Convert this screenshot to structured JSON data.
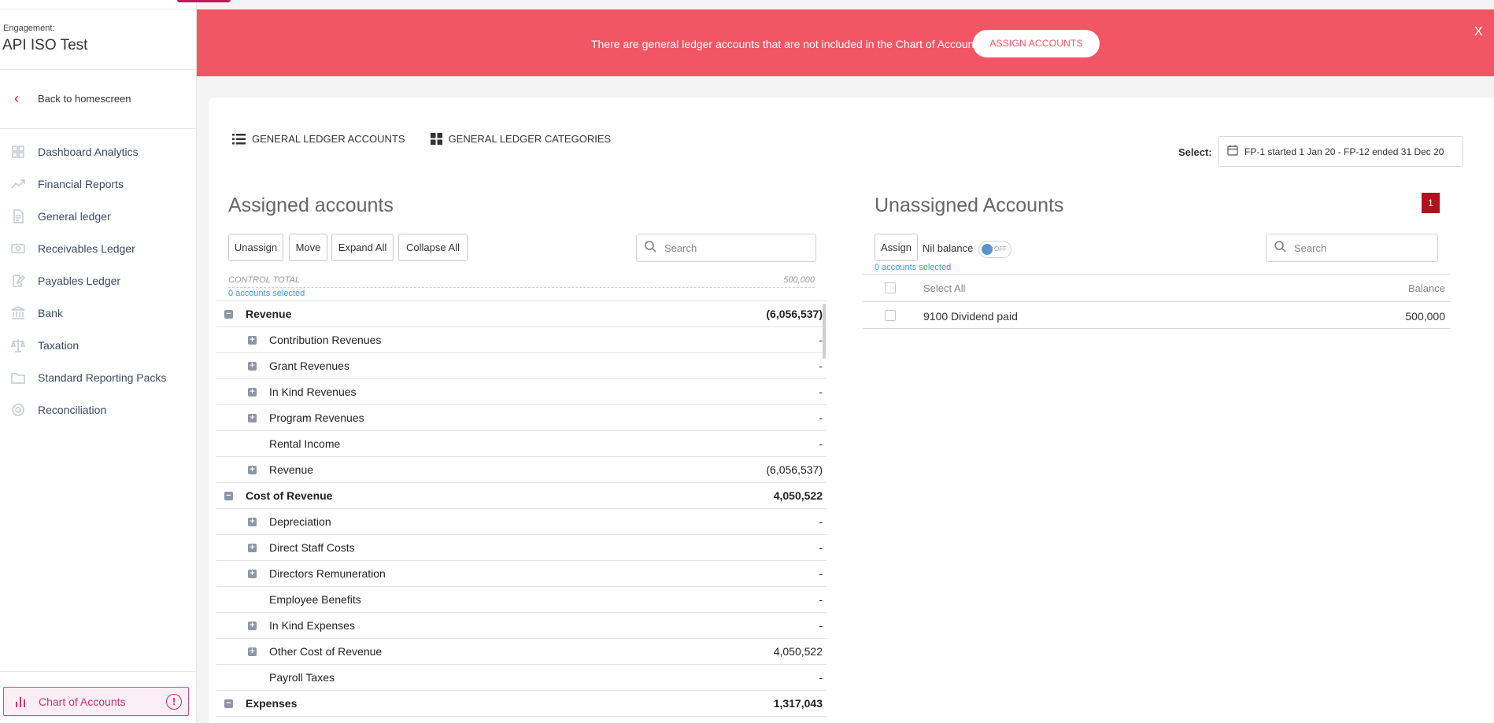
{
  "engagement": {
    "label": "Engagement:",
    "name": "API ISO Test"
  },
  "back_label": "Back to homescreen",
  "nav": [
    {
      "label": "Dashboard Analytics",
      "icon": "dashboard-icon"
    },
    {
      "label": "Financial Reports",
      "icon": "trend-icon"
    },
    {
      "label": "General ledger",
      "icon": "document-icon"
    },
    {
      "label": "Receivables Ledger",
      "icon": "money-icon"
    },
    {
      "label": "Payables Ledger",
      "icon": "edit-icon"
    },
    {
      "label": "Bank",
      "icon": "bank-icon"
    },
    {
      "label": "Taxation",
      "icon": "scales-icon"
    },
    {
      "label": "Standard Reporting Packs",
      "icon": "folder-icon"
    },
    {
      "label": "Reconciliation",
      "icon": "target-icon"
    }
  ],
  "chart_of_accounts": {
    "label": "Chart of Accounts",
    "warning": "!"
  },
  "banner": {
    "message": "There are general ledger accounts that are not included in the Chart of Accounts",
    "button": "ASSIGN ACCOUNTS",
    "close": "X"
  },
  "tabs": {
    "accounts": "GENERAL LEDGER ACCOUNTS",
    "categories": "GENERAL LEDGER CATEGORIES"
  },
  "select": {
    "label": "Select:",
    "value": "FP-1 started 1 Jan 20 - FP-12 ended 31 Dec 20"
  },
  "assigned": {
    "title": "Assigned accounts",
    "buttons": {
      "unassign": "Unassign",
      "move": "Move",
      "expand": "Expand All",
      "collapse": "Collapse All"
    },
    "search_placeholder": "Search",
    "control_total_label": "CONTROL TOTAL",
    "control_total_value": "500,000",
    "selected": "0 accounts selected",
    "rows": [
      {
        "level": "parent",
        "toggle": "−",
        "label": "Revenue",
        "amount": "(6,056,537)"
      },
      {
        "level": "child",
        "toggle": "+",
        "label": "Contribution Revenues",
        "amount": "-"
      },
      {
        "level": "child",
        "toggle": "+",
        "label": "Grant Revenues",
        "amount": "-"
      },
      {
        "level": "child",
        "toggle": "+",
        "label": "In Kind Revenues",
        "amount": "-"
      },
      {
        "level": "child",
        "toggle": "+",
        "label": "Program Revenues",
        "amount": "-"
      },
      {
        "level": "child",
        "toggle": "",
        "label": "Rental Income",
        "amount": "-"
      },
      {
        "level": "child",
        "toggle": "+",
        "label": "Revenue",
        "amount": "(6,056,537)"
      },
      {
        "level": "parent",
        "toggle": "−",
        "label": "Cost of Revenue",
        "amount": "4,050,522"
      },
      {
        "level": "child",
        "toggle": "+",
        "label": "Depreciation",
        "amount": "-"
      },
      {
        "level": "child",
        "toggle": "+",
        "label": "Direct Staff Costs",
        "amount": "-"
      },
      {
        "level": "child",
        "toggle": "+",
        "label": "Directors Remuneration",
        "amount": "-"
      },
      {
        "level": "child",
        "toggle": "",
        "label": "Employee Benefits",
        "amount": "-"
      },
      {
        "level": "child",
        "toggle": "+",
        "label": "In Kind Expenses",
        "amount": "-"
      },
      {
        "level": "child",
        "toggle": "+",
        "label": "Other Cost of Revenue",
        "amount": "4,050,522"
      },
      {
        "level": "child",
        "toggle": "",
        "label": "Payroll Taxes",
        "amount": "-"
      },
      {
        "level": "parent",
        "toggle": "−",
        "label": "Expenses",
        "amount": "1,317,043"
      }
    ]
  },
  "unassigned": {
    "title": "Unassigned Accounts",
    "badge": "1",
    "assign_button": "Assign",
    "nil_balance_label": "Nil balance",
    "toggle_state": "OFF",
    "selected": "0 accounts selected",
    "search_placeholder": "Search",
    "header": {
      "select_all": "Select All",
      "balance": "Balance"
    },
    "rows": [
      {
        "label": "9100 Dividend paid",
        "balance": "500,000"
      }
    ]
  }
}
